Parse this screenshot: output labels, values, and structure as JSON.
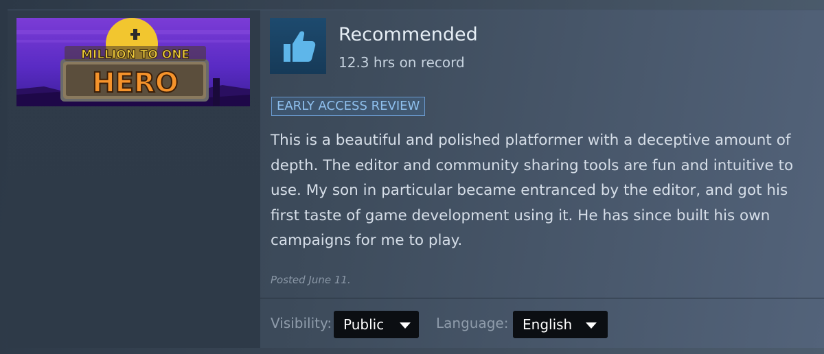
{
  "game": {
    "capsule_title_line1": "MILLION TO ONE",
    "capsule_title_line2": "HERO"
  },
  "review": {
    "thumb_icon": "thumbs-up-icon",
    "status": "Recommended",
    "hours": "12.3 hrs on record",
    "badge": "EARLY ACCESS REVIEW",
    "text": "This is a beautiful and polished platformer with a deceptive amount of depth. The editor and community sharing tools are fun and intuitive to use. My son in particular became entranced by the editor, and got his first taste of game development using it. He has since built his own campaigns for me to play.",
    "posted": "Posted June 11."
  },
  "controls": {
    "visibility_label": "Visibility:",
    "visibility_value": "Public",
    "language_label": "Language:",
    "language_value": "English"
  },
  "colors": {
    "badge_text": "#8fc0ee",
    "badge_border": "#6b9bd0",
    "thumb": "#5eb6ea",
    "dropdown_bg": "#0b0e12"
  }
}
